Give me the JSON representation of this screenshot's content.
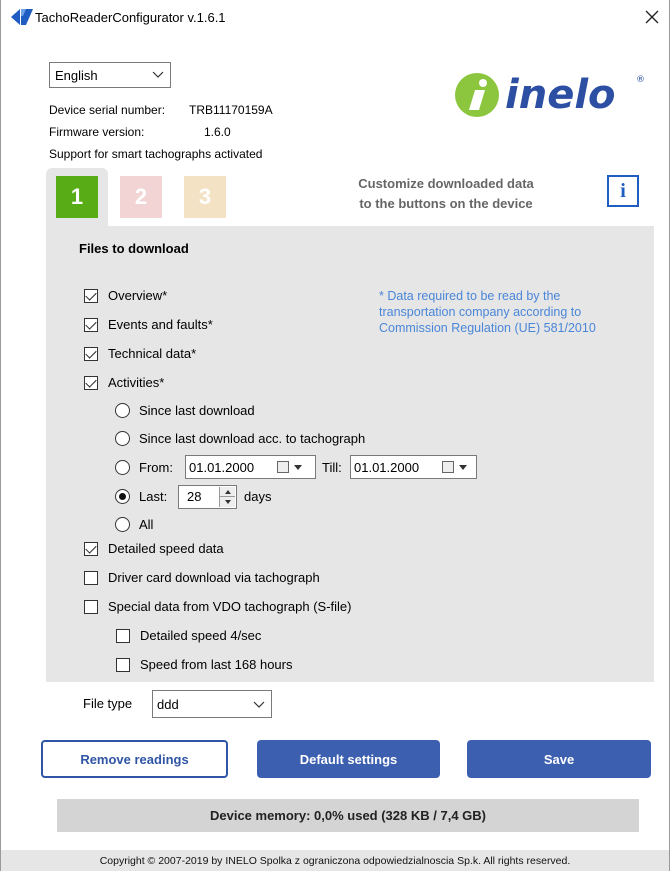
{
  "window": {
    "title": "TachoReaderConfigurator v.1.6.1"
  },
  "language": {
    "selected": "English"
  },
  "device": {
    "serial_label": "Device serial number:",
    "serial_value": "TRB11170159A",
    "firmware_label": "Firmware version:",
    "firmware_value": "1.6.0",
    "smart_support": "Support for smart tachographs activated"
  },
  "logo": {
    "text": "inelo",
    "registered": "®",
    "brand_color": "#2c4fa3",
    "mark_color": "#8cc63f"
  },
  "tabs": [
    {
      "label": "1",
      "color": "#58ac15",
      "active": true
    },
    {
      "label": "2",
      "color": "#f2d4d4",
      "active": false
    },
    {
      "label": "3",
      "color": "#f4e2c4",
      "active": false
    }
  ],
  "customize": {
    "line1": "Customize downloaded data",
    "line2": "to the buttons on the device"
  },
  "info_button": {
    "label": "i"
  },
  "files": {
    "title": "Files to download",
    "overview": {
      "label": "Overview*",
      "checked": true
    },
    "events": {
      "label": "Events and faults*",
      "checked": true
    },
    "technical": {
      "label": "Technical data*",
      "checked": true
    },
    "activities": {
      "label": "Activities*",
      "checked": true
    },
    "note": "* Data required to be read by the transportation company according to Commission Regulation (UE) 581/2010",
    "activity_options": {
      "since_last": {
        "label": "Since last download",
        "selected": false
      },
      "since_last_tacho": {
        "label": "Since last download acc. to tachograph",
        "selected": false
      },
      "from": {
        "label": "From:",
        "selected": false,
        "from_date": "01.01.2000",
        "till_label": "Till:",
        "till_date": "01.01.2000"
      },
      "last": {
        "label": "Last:",
        "selected": true,
        "days_value": "28",
        "days_label": "days"
      },
      "all": {
        "label": "All",
        "selected": false
      }
    },
    "detailed_speed": {
      "label": "Detailed speed data",
      "checked": true
    },
    "driver_card": {
      "label": "Driver card download via tachograph",
      "checked": false
    },
    "special_vdo": {
      "label": "Special data from VDO tachograph (S-file)",
      "checked": false
    },
    "detailed_speed_4": {
      "label": "Detailed speed 4/sec",
      "checked": false
    },
    "speed_168": {
      "label": "Speed from last 168 hours",
      "checked": false
    }
  },
  "file_type": {
    "label": "File type",
    "selected": "ddd"
  },
  "buttons": {
    "remove": "Remove readings",
    "default": "Default settings",
    "save": "Save"
  },
  "memory": {
    "text": "Device memory: 0,0% used (328 KB / 7,4 GB)",
    "used_fraction": 0.0
  },
  "footer": {
    "copyright": "Copyright © 2007-2019 by INELO Spolka z ograniczona odpowiedzialnoscia Sp.k. All rights reserved."
  }
}
